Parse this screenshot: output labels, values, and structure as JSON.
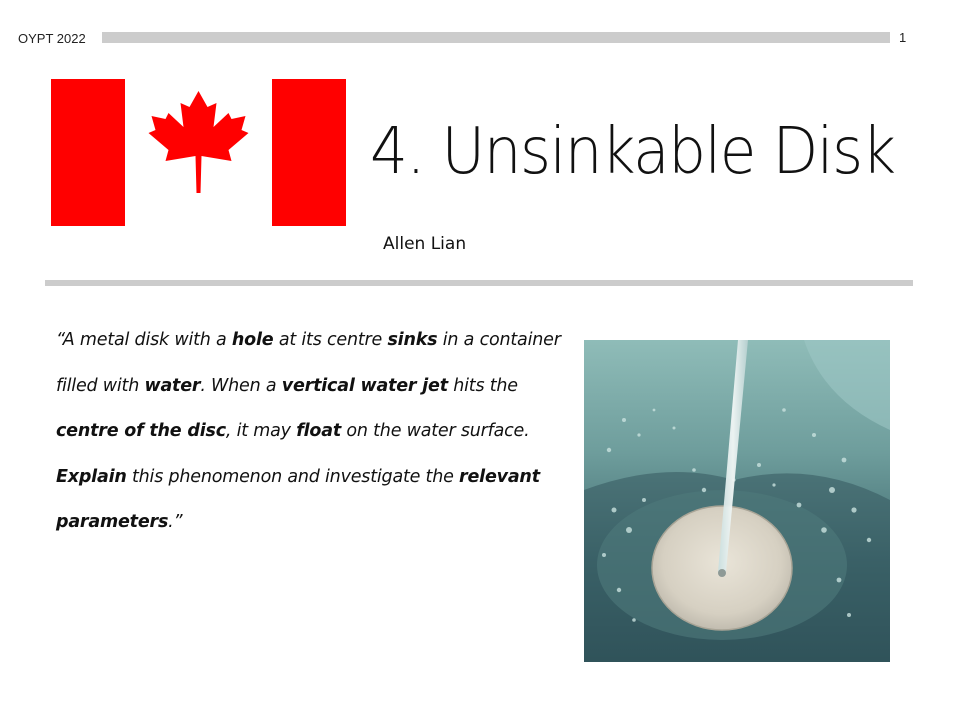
{
  "header": {
    "event_label": "OYPT 2022",
    "page_number": "1"
  },
  "colors": {
    "flag_red": "#ff0000",
    "header_bar": "#cccccc",
    "divider": "#cccccc"
  },
  "title": "4. Unsinkable Disk",
  "author": "Allen Lian",
  "problem": {
    "segments": [
      {
        "text": "“A metal disk with a ",
        "bold": false
      },
      {
        "text": "hole",
        "bold": true
      },
      {
        "text": " at its centre ",
        "bold": false
      },
      {
        "text": "sinks",
        "bold": true
      },
      {
        "text": " in a container filled with ",
        "bold": false
      },
      {
        "text": "water",
        "bold": true
      },
      {
        "text": ". When a ",
        "bold": false
      },
      {
        "text": "vertical water jet",
        "bold": true
      },
      {
        "text": " hits the ",
        "bold": false
      },
      {
        "text": "centre of the disc",
        "bold": true
      },
      {
        "text": ", it may ",
        "bold": false
      },
      {
        "text": "float",
        "bold": true
      },
      {
        "text": " on the water surface. ",
        "bold": false
      },
      {
        "text": "Explain",
        "bold": true
      },
      {
        "text": " this phenomenon and investigate the ",
        "bold": false
      },
      {
        "text": "relevant parameters",
        "bold": true
      },
      {
        "text": ".”",
        "bold": false
      }
    ]
  }
}
